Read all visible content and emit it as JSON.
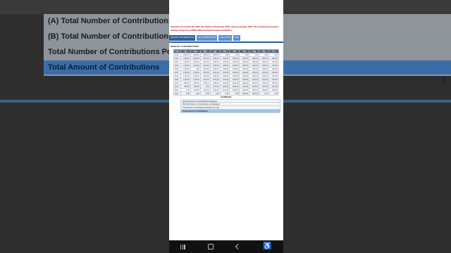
{
  "background": {
    "rows": [
      {
        "label": "(A) Total Number of Contributions D",
        "highlight": false
      },
      {
        "label": "(B) Total Number of Contributions n",
        "highlight": false
      },
      {
        "label": "Total Number of Contributions Post",
        "highlight": false
      },
      {
        "label": "Total Amount of Contributions",
        "highlight": true
      }
    ],
    "value": "1"
  },
  "notice": "Pursuant to Circular No. 2020-032 dated 24 November 2020, starting January 2021, SS contribution includes Savings Program or WISP (SSS Provident Fund) contribution.",
  "tabs": [
    {
      "label": "MONTHLY CONTRIBUTIONS",
      "active": true
    },
    {
      "label": "EC CONTRIBUTIONS",
      "active": false
    },
    {
      "label": "FLEXI FUND",
      "active": false
    },
    {
      "label": "WISP",
      "active": false
    }
  ],
  "section_title": "MONTHLY CONTRIBUTIONS",
  "table": {
    "headers": [
      "Year",
      "Jan",
      "Feb",
      "Mar",
      "Apr",
      "May",
      "Jun",
      "Jul",
      "Aug",
      "Sep",
      "Oct"
    ],
    "rows": [
      [
        "2022",
        "1600.00",
        "1600.00",
        "1600.00",
        "1600.00",
        "0.00",
        "0.00",
        "0.00",
        "0.00",
        "0.00",
        "0.00"
      ],
      [
        "2021",
        "1600.00",
        "1600.00",
        "1600.00",
        "1600.00",
        "1600.00",
        "1600.00",
        "1600.00",
        "1600.00",
        "1600.00",
        "1600.00"
      ],
      [
        "2020",
        "1760.00",
        "1760.00",
        "1760.00",
        "1760.00",
        "1760.00",
        "1760.00",
        "1760.00",
        "1760.00",
        "1760.00",
        "1760.00"
      ],
      [
        "2019",
        "1760.00",
        "1760.00",
        "1760.00",
        "1760.00",
        "1760.00",
        "1760.00",
        "1760.00",
        "1760.00",
        "1760.00",
        "1760.00"
      ],
      [
        "2018",
        "1760.00",
        "0.00",
        "1760.00",
        "1760.00",
        "1760.00",
        "1760.00",
        "1760.00",
        "1760.00",
        "1600.00",
        "1760.00"
      ],
      [
        "2017",
        "1760.00",
        "1760.00",
        "1760.00",
        "1760.00",
        "1760.00",
        "1760.00",
        "1760.00",
        "1760.00",
        "1760.00",
        "1760.00"
      ],
      [
        "2016",
        "1760.00",
        "1760.00",
        "1760.00",
        "1760.00",
        "1760.00",
        "1760.00",
        "1760.00",
        "1760.00",
        "1760.00",
        "1760.00"
      ],
      [
        "2015",
        "1760.00",
        "1760.00",
        "1760.00",
        "1760.00",
        "1760.00",
        "1760.00",
        "1760.00",
        "1760.00",
        "1760.00",
        "1760.00"
      ],
      [
        "2014",
        "1160.00",
        "1160.00",
        "1760.00",
        "1160.00",
        "1160.00",
        "1160.00",
        "1160.00",
        "1160.00",
        "1760.00",
        "1760.00"
      ],
      [
        "2013",
        "880.00",
        "880.00",
        "0.00",
        "1170.00",
        "1160.00",
        "1160.00",
        "1170.00",
        "1170.00",
        "1170.00",
        "1170.00"
      ],
      [
        "2012",
        "0.00",
        "1160.00",
        "1160.00",
        "1160.00",
        "1160.00",
        "1160.00",
        "1160.00",
        "1160.00",
        "1160.00",
        "1160.00"
      ],
      [
        "2011",
        "0.00",
        "0.00",
        "0.00",
        "0.00",
        "0.00",
        "0.00",
        "1160.00",
        "1160.00",
        "0.00",
        "0.00"
      ]
    ]
  },
  "summary": {
    "title": "SUMMARY",
    "rows": [
      {
        "label": "(A) Total Number of Contributions Displayed",
        "highlight": false
      },
      {
        "label": "(B) Total Number of Contributions not Displayed",
        "highlight": false
      },
      {
        "label": "Total Number of Contributions Posted (A) + (B)",
        "highlight": false
      },
      {
        "label": "Total Amount of Contributions",
        "highlight": true
      }
    ]
  },
  "navbar": {
    "recent": "recent-apps-icon",
    "home": "home-icon",
    "back": "back-icon",
    "accessibility": "accessibility-icon"
  }
}
